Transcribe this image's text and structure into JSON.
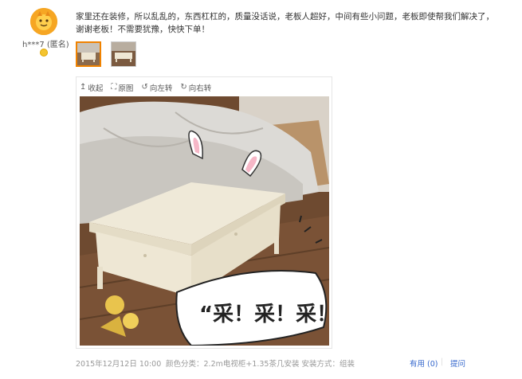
{
  "review": {
    "username": "h***7 (匿名)",
    "text": "家里还在装修，所以乱乱的，东西杠杠的，质量没话说，老板人超好，中间有些小问题，老板即使帮我们解决了，谢谢老板！不需要犹豫，快快下单！",
    "toolbar": {
      "collapse_label": "收起",
      "original_label": "原图",
      "rotate_left_label": "向左转",
      "rotate_right_label": "向右转"
    },
    "photo_sticker_text": "“采！采！采！”",
    "footer": {
      "date": "2015年12月12日 10:00",
      "specs": "颜色分类：2.2m电视柜+1.35茶几安装   安装方式：组装",
      "useful": "有用 (0)",
      "separator": "|",
      "ask": "提问"
    }
  },
  "colors": {
    "accent_orange": "#f08200",
    "link_blue": "#3366cc",
    "meta_gray": "#999999"
  }
}
